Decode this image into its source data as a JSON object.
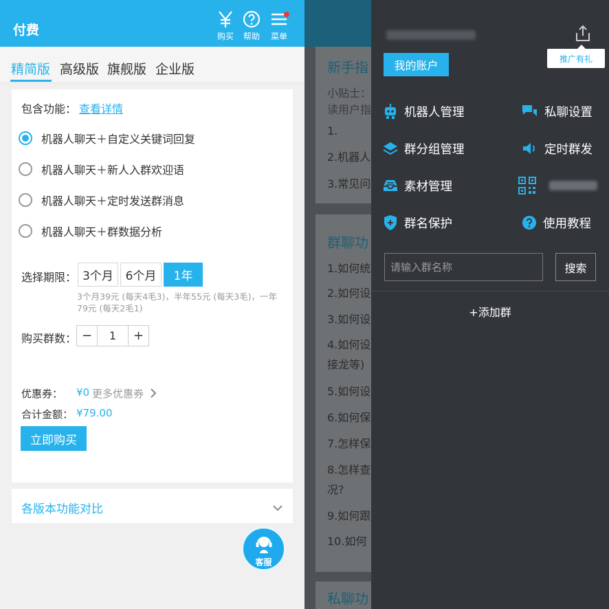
{
  "header": {
    "title": "付费",
    "buy_label": "购买",
    "help_label": "帮助",
    "menu_label": "菜单",
    "colors": {
      "primary": "#27b2ec",
      "badge": "#ec3a3a"
    }
  },
  "tabs": [
    "精简版",
    "高级版",
    "旗舰版",
    "企业版"
  ],
  "active_tab": "精简版",
  "features": {
    "label": "包含功能：",
    "link": "查看详情",
    "options": [
      {
        "text": "机器人聊天＋自定义关键词回复",
        "selected": true
      },
      {
        "text": "机器人聊天＋新人入群欢迎语",
        "selected": false
      },
      {
        "text": "机器人聊天＋定时发送群消息",
        "selected": false
      },
      {
        "text": "机器人聊天＋群数据分析",
        "selected": false
      }
    ]
  },
  "period": {
    "label": "选择期限：",
    "options": [
      "3个月",
      "6个月",
      "1年"
    ],
    "selected": "1年",
    "note": "3个月39元 (每天4毛3)，半年55元 (每天3毛)，一年79元 (每天2毛1)"
  },
  "quantity": {
    "label": "购买群数：",
    "minus": "−",
    "value": "1",
    "plus": "+"
  },
  "coupon": {
    "label": "优惠券：",
    "value": "¥0",
    "more": "更多优惠券"
  },
  "total": {
    "label": "合计金额：",
    "value": "¥79.00"
  },
  "buy_button": "立即购买",
  "compare": "各版本功能对比",
  "support": "客服",
  "background_page": {
    "heading_1": "新手指",
    "tip_lines": [
      "小贴士：",
      "读用户指"
    ],
    "items_1": [
      "1.",
      "2.机器人",
      "3.常见问"
    ],
    "heading_2": "群聊功",
    "items_2": [
      "1.如何统",
      "2.如何设",
      "3.如何设",
      "4.如何设",
      "接龙等)",
      "5.如何设",
      "6.如何保",
      "7.怎样保",
      "8.怎样查",
      "况?",
      "9.如何跟",
      "10.如何"
    ],
    "heading_3": "私聊功"
  },
  "drawer": {
    "promo": "推广有礼",
    "account": "我的账户",
    "menu": [
      {
        "label": "机器人管理",
        "icon": "robot-icon"
      },
      {
        "label": "私聊设置",
        "icon": "chat-bubbles-icon"
      },
      {
        "label": "群分组管理",
        "icon": "layers-icon"
      },
      {
        "label": "定时群发",
        "icon": "speaker-icon"
      },
      {
        "label": "素材管理",
        "icon": "inbox-icon"
      },
      {
        "label": "",
        "icon": "qr-code-icon"
      },
      {
        "label": "群名保护",
        "icon": "shield-icon"
      },
      {
        "label": "使用教程",
        "icon": "help-icon"
      }
    ],
    "search_placeholder": "请输入群名称",
    "search_button": "搜索",
    "add_group": "+添加群"
  }
}
